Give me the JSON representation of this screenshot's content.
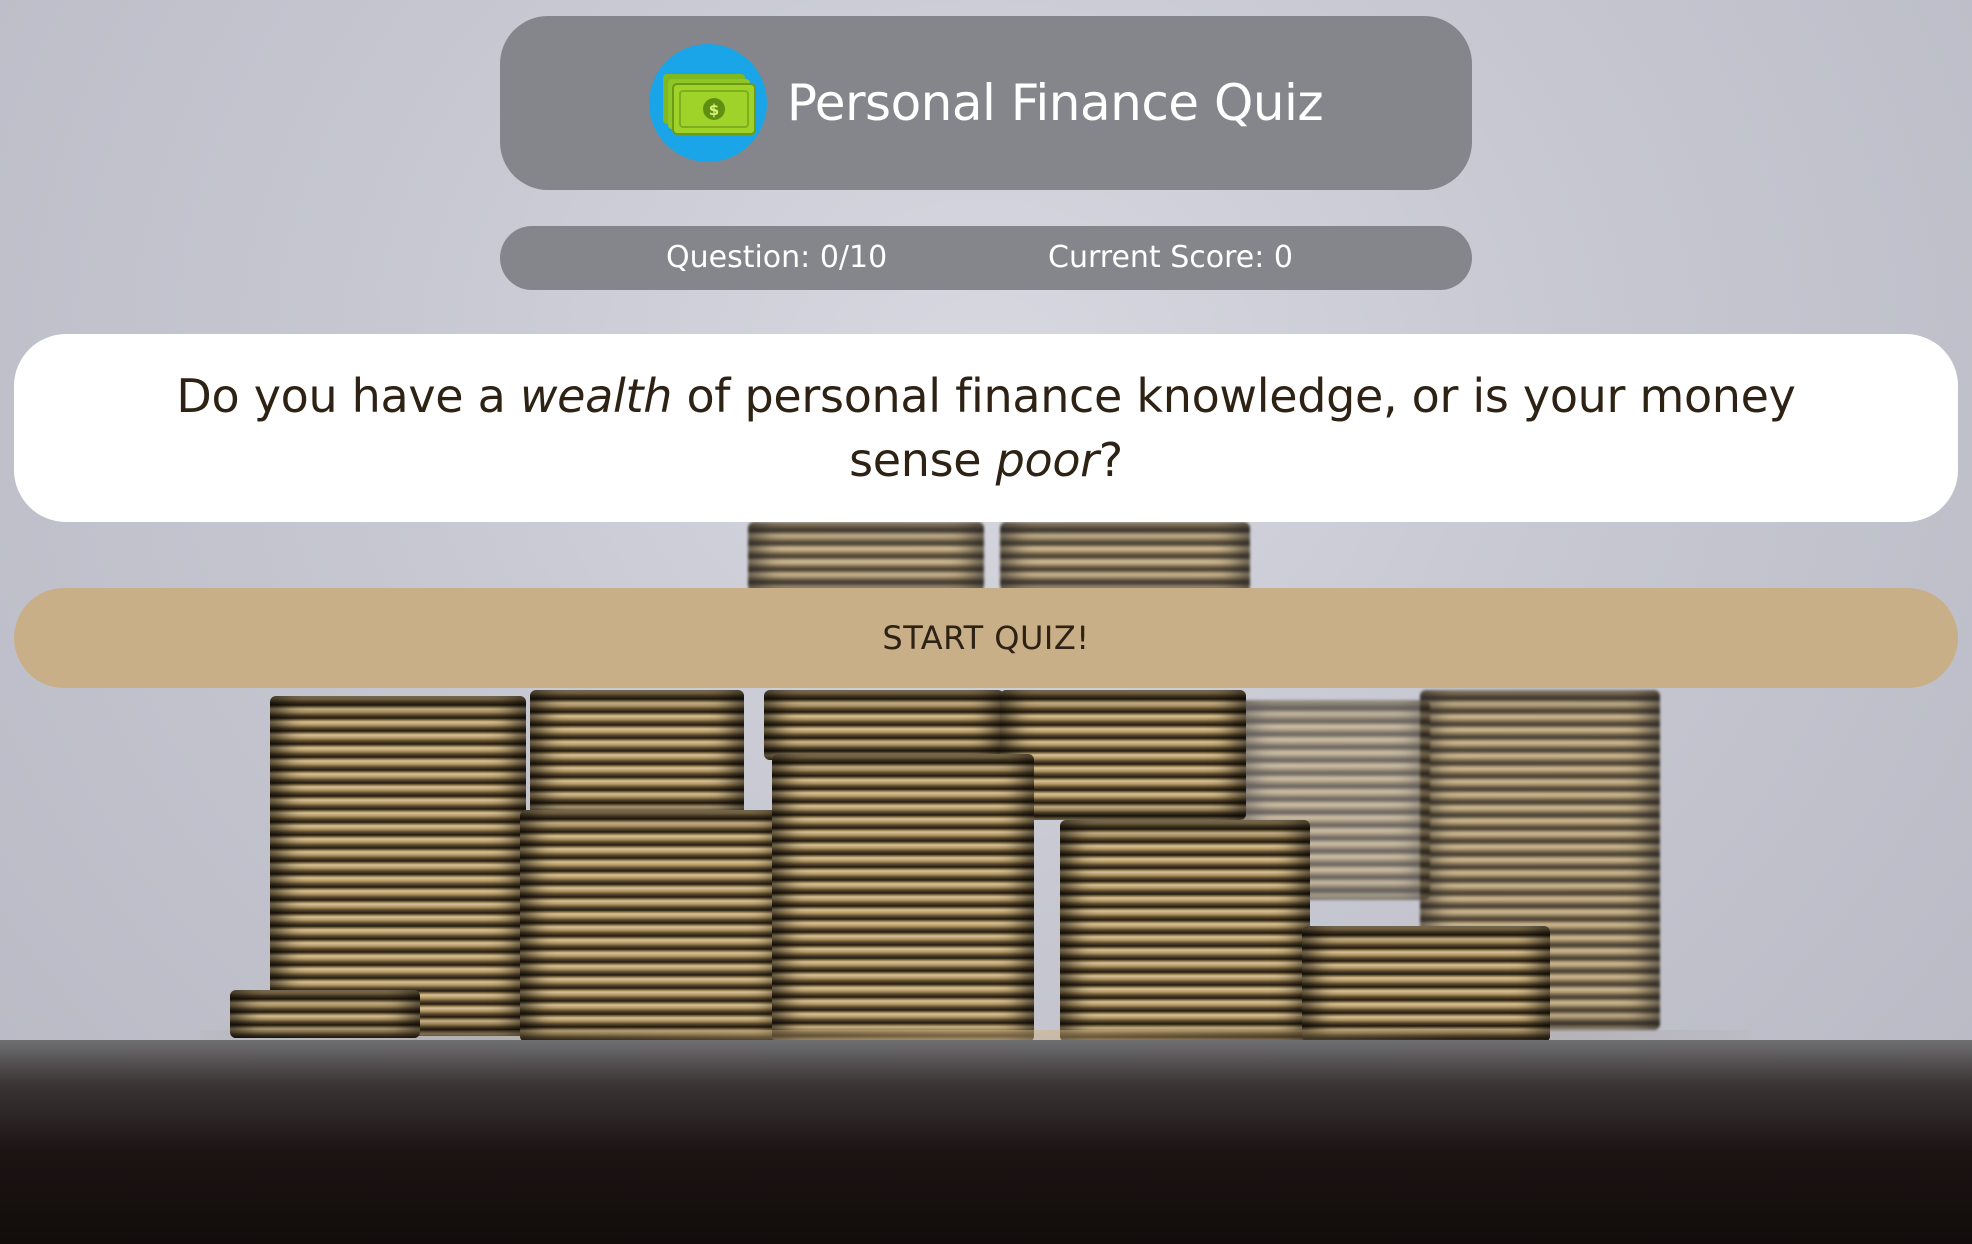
{
  "header": {
    "title": "Personal Finance Quiz",
    "logo_icon": "money-bills-icon",
    "logo_symbol": "$"
  },
  "status": {
    "question_label": "Question: 0/10",
    "score_label": "Current Score: 0"
  },
  "question": {
    "part1": "Do you have a ",
    "emphasis1": "wealth",
    "part2": " of personal finance knowledge, or is your money sense ",
    "emphasis2": "poor",
    "part3": "?"
  },
  "actions": {
    "start_label": "START QUIZ!"
  },
  "colors": {
    "panel": "#85868b",
    "logo_bg": "#1aa5e8",
    "bill": "#9fd32a",
    "button": "#c9af88",
    "text_dark": "#2d2214"
  }
}
